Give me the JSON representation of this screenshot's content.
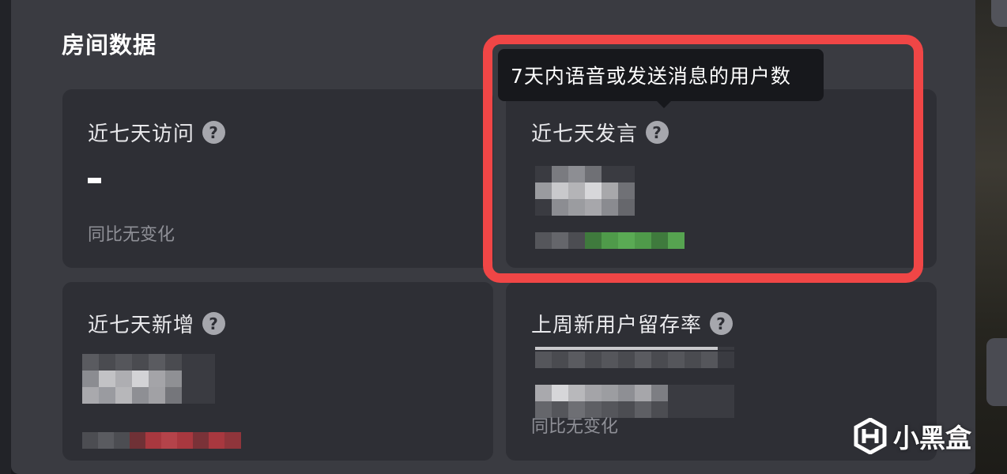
{
  "section": {
    "title": "房间数据"
  },
  "cards": {
    "visits": {
      "title": "近七天访问",
      "value": "-",
      "compare": "同比无变化"
    },
    "speakers": {
      "title": "近七天发言"
    },
    "new_users": {
      "title": "近七天新增"
    },
    "retention": {
      "title": "上周新用户留存率",
      "compare": "同比无变化"
    }
  },
  "tooltip": {
    "text": "7天内语音或发送消息的用户数"
  },
  "icons": {
    "help": "question-mark-icon",
    "watermark": "xiaoheihe-logo"
  },
  "watermark": {
    "text": "小黑盒"
  },
  "colors": {
    "panel": "#3a3b41",
    "card": "#2e2f35",
    "highlight": "#f04646",
    "tooltip_bg": "#17181c",
    "trend_up": "#4f9a4a",
    "trend_down": "#a8383f"
  }
}
